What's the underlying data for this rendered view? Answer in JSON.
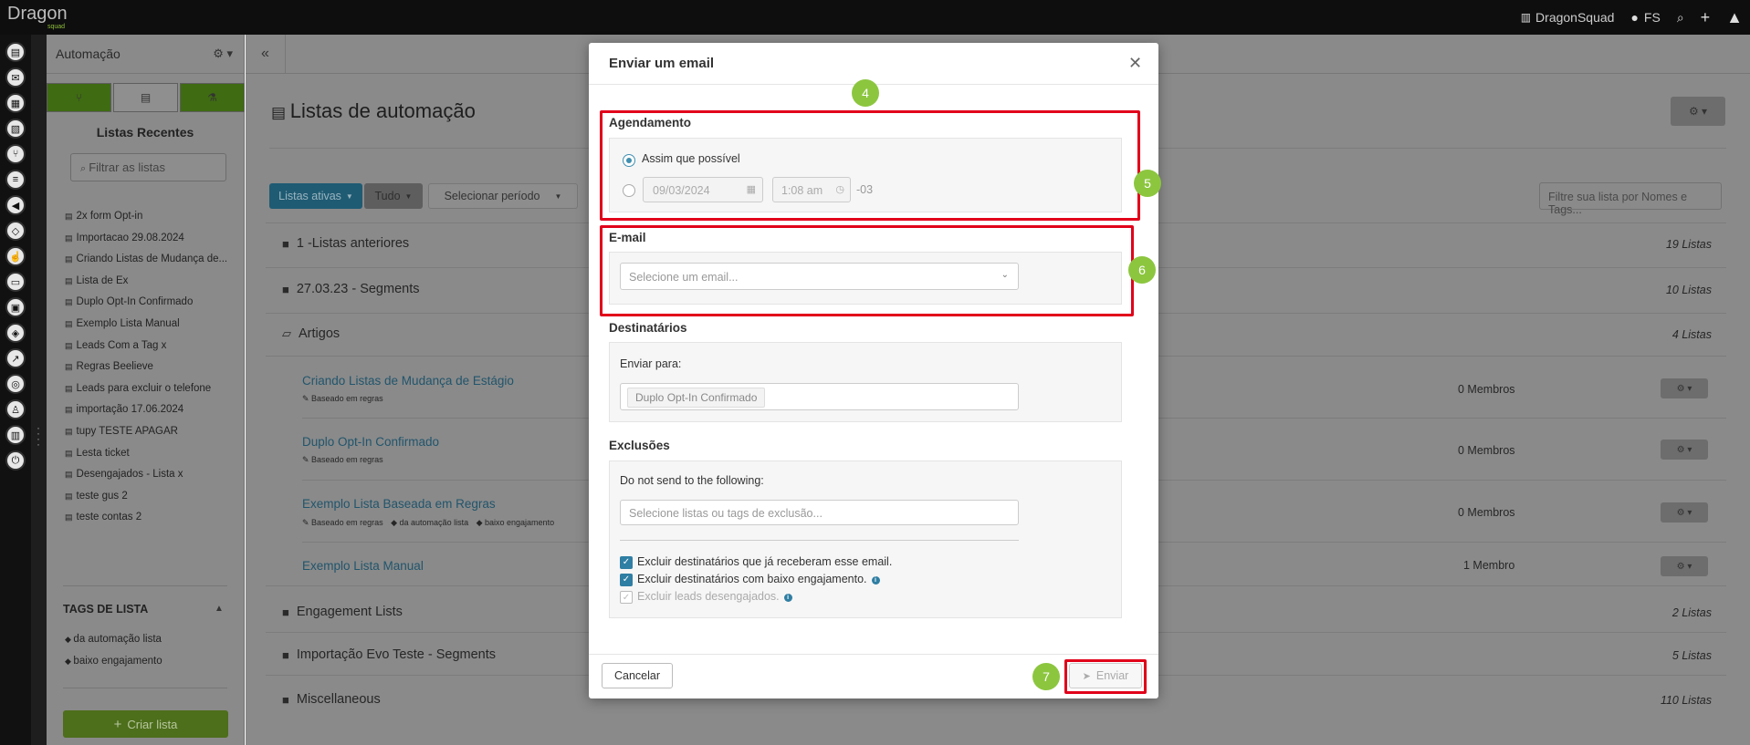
{
  "app": {
    "logo": "Dragon",
    "logo_sub": "squad"
  },
  "topbar": {
    "workspace": "DragonSquad",
    "user": "FS"
  },
  "sidebar": {
    "title": "Automação",
    "section_title": "Listas Recentes",
    "filter_placeholder": "Filtrar as listas",
    "recent_lists": [
      "2x form Opt-in",
      "Importacao 29.08.2024",
      "Criando Listas de Mudança de...",
      "Lista de Ex",
      "Duplo Opt-In Confirmado",
      "Exemplo Lista Manual",
      "Leads Com a Tag x",
      "Regras Beelieve",
      "Leads para excluir o telefone",
      "importação 17.06.2024",
      "tupy TESTE APAGAR",
      "Lesta ticket",
      "Desengajados - Lista x",
      "teste gus 2",
      "teste contas 2"
    ],
    "tags_title": "TAGS DE LISTA",
    "tags": [
      "da automação lista",
      "baixo engajamento"
    ],
    "create_label": "Criar lista"
  },
  "main": {
    "title": "Listas de automação",
    "filters": {
      "active": "Listas ativas",
      "all": "Tudo",
      "period": "Selecionar período"
    },
    "search_placeholder": "Filtre sua lista por Nomes e Tags...",
    "folders": [
      {
        "name": "1 -Listas anteriores",
        "count": "19 Listas"
      },
      {
        "name": "27.03.23 - Segments",
        "count": "10 Listas"
      },
      {
        "name": "Artigos",
        "count": "4 Listas"
      },
      {
        "name": "Engagement Lists",
        "count": "2 Listas"
      },
      {
        "name": "Importação Evo Teste - Segments",
        "count": "5 Listas"
      },
      {
        "name": "Miscellaneous",
        "count": "110 Listas"
      }
    ],
    "rows": [
      {
        "name": "Criando Listas de Mudança de Estágio",
        "meta": [
          "Baseado em regras"
        ],
        "members": "0 Membros"
      },
      {
        "name": "Duplo Opt-In Confirmado",
        "meta": [
          "Baseado em regras"
        ],
        "members": "0 Membros"
      },
      {
        "name": "Exemplo Lista Baseada em Regras",
        "meta": [
          "Baseado em regras",
          "da automação lista",
          "baixo engajamento"
        ],
        "members": "0 Membros"
      },
      {
        "name": "Exemplo Lista Manual",
        "meta": [],
        "members": "1 Membro"
      }
    ]
  },
  "modal": {
    "title": "Enviar um email",
    "steps": [
      "4",
      "5",
      "6",
      "7"
    ],
    "schedule": {
      "label": "Agendamento",
      "asap": "Assim que possível",
      "date": "09/03/2024",
      "time": "1:08 am",
      "tz": "-03"
    },
    "email": {
      "label": "E-mail",
      "placeholder": "Selecione um email..."
    },
    "recipients": {
      "label": "Destinatários",
      "send_to": "Enviar para:",
      "chip": "Duplo Opt-In Confirmado"
    },
    "exclusions": {
      "label": "Exclusões",
      "do_not_send": "Do not send to the following:",
      "placeholder": "Selecione listas ou tags de exclusão...",
      "options": [
        "Excluir destinatários que já receberam esse email.",
        "Excluir destinatários com baixo engajamento.",
        "Excluir leads desengajados."
      ]
    },
    "cancel": "Cancelar",
    "send": "Enviar"
  },
  "colors": {
    "highlight": "#e1001a",
    "step": "#8cc63f",
    "accent": "#2f7ea3"
  }
}
